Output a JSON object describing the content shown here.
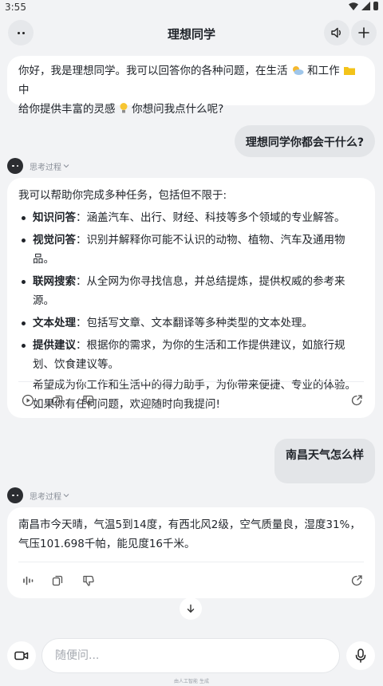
{
  "status": {
    "time": "3:55"
  },
  "header": {
    "title": "理想同学"
  },
  "greeting": {
    "line1_a": "你好，我是理想同学。我可以回答你的各种问题，在生活",
    "line1_b": "和工作",
    "line1_c": "中",
    "line2_a": "给你提供丰富的灵感",
    "line2_b": "你想问我点什么呢?"
  },
  "messages": {
    "user1": "理想同学你都会干什么?",
    "think_label": "思考过程",
    "answer1": {
      "intro": "我可以帮助你完成多种任务，包括但不限于:",
      "items": [
        {
          "title": "知识问答",
          "text": "：涵盖汽车、出行、财经、科技等多个领域的专业解答。"
        },
        {
          "title": "视觉问答",
          "text": "：识别并解释你可能不认识的动物、植物、汽车及通用物品。"
        },
        {
          "title": "联网搜索",
          "text": "：从全网为你寻找信息，并总结提炼，提供权威的参考来源。"
        },
        {
          "title": "文本处理",
          "text": "：包括写文章、文本翻译等多种类型的文本处理。"
        },
        {
          "title": "提供建议",
          "text": "：根据你的需求，为你的生活和工作提供建议，如旅行规划、饮食建议等。"
        }
      ],
      "outro": "希望成为你工作和生活中的得力助手，为你带来便捷、专业的体验。如果你有任何问题，欢迎随时向我提问!"
    },
    "user2": "南昌天气怎么样",
    "answer2": "南昌市今天晴，气温5到14度，有西北风2级，空气质量良，湿度31%，气压101.698千帕，能见度16千米。"
  },
  "composer": {
    "placeholder": "随便问..."
  },
  "footnote": "由人工智能 生成",
  "colors": {
    "background": "#f2f3f5",
    "bubble_ai": "#ffffff",
    "bubble_user": "#e3e5e8",
    "accent_dark": "#2b2d31"
  }
}
